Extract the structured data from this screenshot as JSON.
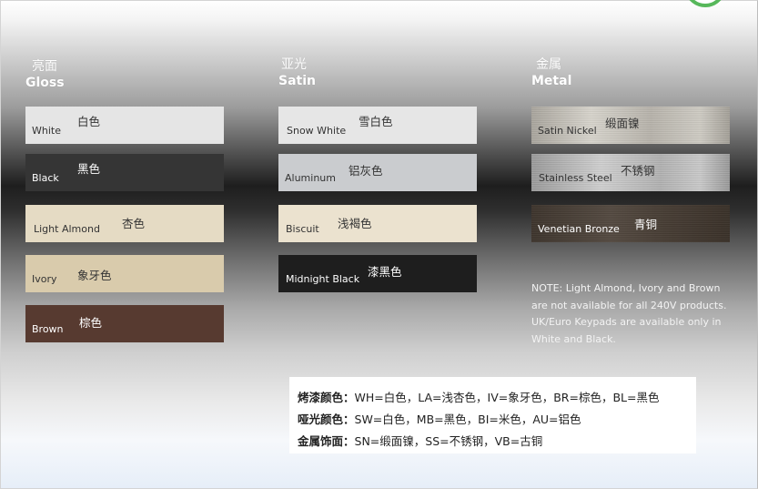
{
  "columns": {
    "gloss": {
      "title_cn": "亮面",
      "title_en": "Gloss",
      "items": [
        {
          "en": "White",
          "cn": "白色",
          "color": "#e5e5e5",
          "text": "dark"
        },
        {
          "en": "Black",
          "cn": "黑色",
          "color": "#353535",
          "text": "light"
        },
        {
          "en": "Light Almond",
          "cn": "杏色",
          "color": "#e5dbc4",
          "text": "dark"
        },
        {
          "en": "Ivory",
          "cn": "象牙色",
          "color": "#d9cbac",
          "text": "dark"
        },
        {
          "en": "Brown",
          "cn": "棕色",
          "color": "#573a30",
          "text": "light"
        }
      ]
    },
    "satin": {
      "title_cn": "亚光",
      "title_en": "Satin",
      "items": [
        {
          "en": "Snow White",
          "cn": "雪白色",
          "color": "#e6e6e6",
          "text": "dark"
        },
        {
          "en": "Aluminum",
          "cn": "铝灰色",
          "color": "#cacccf",
          "text": "dark"
        },
        {
          "en": "Biscuit",
          "cn": "浅褐色",
          "color": "#ebe2cf",
          "text": "dark"
        },
        {
          "en": "Midnight Black",
          "cn": "漆黑色",
          "color": "#1e1e1e",
          "text": "light"
        }
      ]
    },
    "metal": {
      "title_cn": "金属",
      "title_en": "Metal",
      "items": [
        {
          "en": "Satin Nickel",
          "cn": "缎面镍",
          "finish": "metal-nickel",
          "text": "dark"
        },
        {
          "en": "Stainless Steel",
          "cn": "不锈钢",
          "finish": "metal-steel",
          "text": "dark"
        },
        {
          "en": "Venetian Bronze",
          "cn": "青铜",
          "finish": "metal-bronze",
          "text": "light"
        }
      ]
    }
  },
  "note": "NOTE: Light Almond, Ivory and Brown are not available for all 240V products. UK/Euro Keypads are available only in White and Black.",
  "legend": {
    "rows": [
      {
        "label": "烤漆颜色：",
        "text": "WH=白色，LA=浅杏色，IV=象牙色，BR=棕色，BL=黑色"
      },
      {
        "label": "哑光颜色：",
        "text": "SW=白色，MB=黑色，BI=米色，AU=铝色"
      },
      {
        "label": "金属饰面：",
        "text": "SN=缎面镍，SS=不锈钢，VB=古铜"
      }
    ]
  }
}
